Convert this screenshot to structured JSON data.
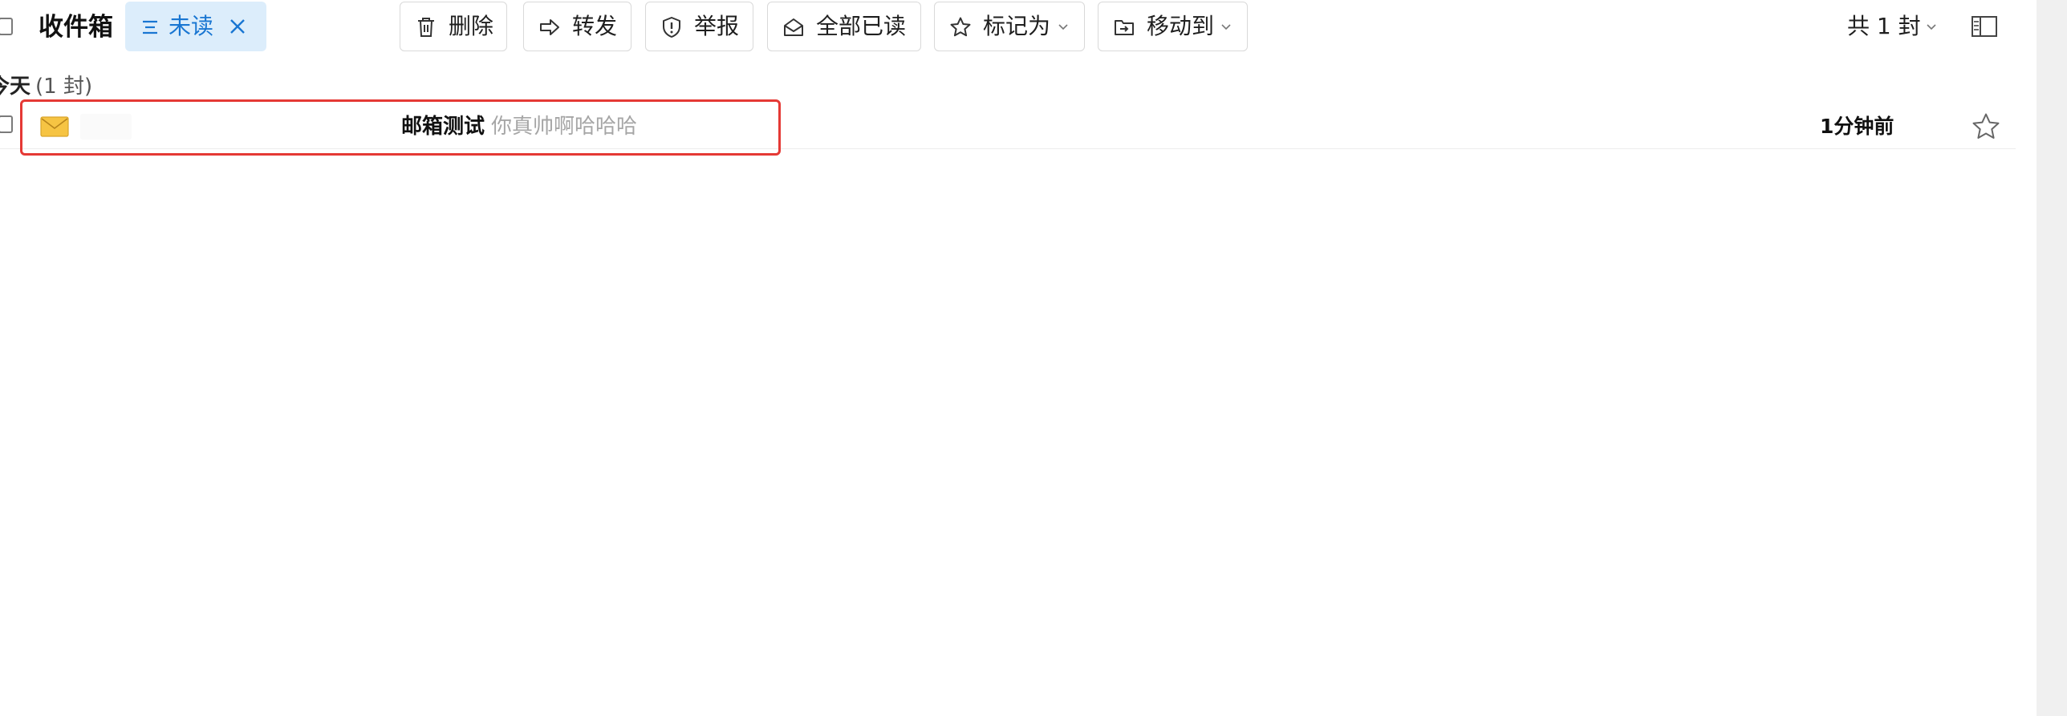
{
  "toolbar": {
    "folder_title": "收件箱",
    "filter_label": "未读",
    "buttons": {
      "delete": "删除",
      "forward": "转发",
      "report": "举报",
      "mark_all_read": "全部已读",
      "mark_as": "标记为",
      "move_to": "移动到"
    },
    "count_text": "共 1 封"
  },
  "groups": [
    {
      "name": "今天",
      "count_text": "(1 封)"
    }
  ],
  "mails": [
    {
      "subject": "邮箱测试",
      "preview": "你真帅啊哈哈哈",
      "time": "1分钟前",
      "starred": false,
      "unread": true
    }
  ],
  "icons": {
    "filter": "filter-lines-icon",
    "clear_filter": "close-icon",
    "delete": "trash-icon",
    "forward": "forward-arrow-icon",
    "report": "shield-alert-icon",
    "mark_all_read": "open-envelope-icon",
    "mark_as": "star-outline-icon",
    "move_to": "folder-move-icon",
    "layout": "reading-pane-icon",
    "mail": "envelope-icon",
    "star": "star-outline-icon"
  },
  "colors": {
    "accent": "#1976d2",
    "chip_bg": "#dcedfb",
    "highlight_border": "#e53935",
    "preview_text": "#a6a6a6",
    "envelope": "#f6c443"
  }
}
